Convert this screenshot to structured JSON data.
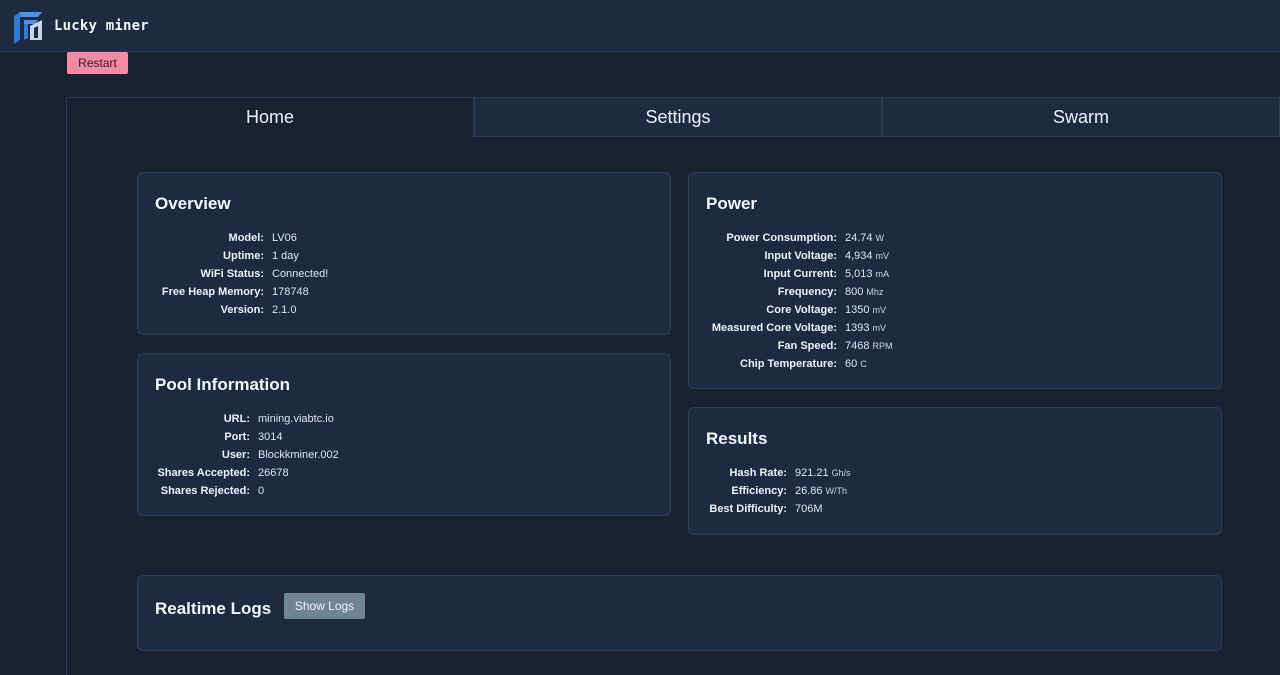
{
  "app": {
    "brand": "Lucky miner",
    "logo_icon": "lucky-miner-logo-icon"
  },
  "toolbar": {
    "restart_label": "Restart"
  },
  "tabs": [
    {
      "label": "Home",
      "active": true
    },
    {
      "label": "Settings",
      "active": false
    },
    {
      "label": "Swarm",
      "active": false
    }
  ],
  "overview": {
    "title": "Overview",
    "rows": [
      {
        "key": "Model:",
        "value": "LV06"
      },
      {
        "key": "Uptime:",
        "value": "1 day"
      },
      {
        "key": "WiFi Status:",
        "value": "Connected!"
      },
      {
        "key": "Free Heap Memory:",
        "value": "178748"
      },
      {
        "key": "Version:",
        "value": "2.1.0"
      }
    ]
  },
  "pool": {
    "title": "Pool Information",
    "rows": [
      {
        "key": "URL:",
        "value": "mining.viabtc.io"
      },
      {
        "key": "Port:",
        "value": "3014"
      },
      {
        "key": "User:",
        "value": "Blockkminer.002"
      },
      {
        "key": "Shares Accepted:",
        "value": "26678"
      },
      {
        "key": "Shares Rejected:",
        "value": "0"
      }
    ]
  },
  "power": {
    "title": "Power",
    "rows": [
      {
        "key": "Power Consumption:",
        "value": "24.74",
        "unit": "W"
      },
      {
        "key": "Input Voltage:",
        "value": "4,934",
        "unit": "mV"
      },
      {
        "key": "Input Current:",
        "value": "5,013",
        "unit": "mA"
      },
      {
        "key": "Frequency:",
        "value": "800",
        "unit": "Mhz"
      },
      {
        "key": "Core Voltage:",
        "value": "1350",
        "unit": "mV"
      },
      {
        "key": "Measured Core Voltage:",
        "value": "1393",
        "unit": "mV"
      },
      {
        "key": "Fan Speed:",
        "value": "7468",
        "unit": "RPM"
      },
      {
        "key": "Chip Temperature:",
        "value": "60",
        "unit": "C"
      }
    ]
  },
  "results": {
    "title": "Results",
    "rows": [
      {
        "key": "Hash Rate:",
        "value": "921.21",
        "unit": "Gh/s"
      },
      {
        "key": "Efficiency:",
        "value": "26.86",
        "unit": "W/Th"
      },
      {
        "key": "Best Difficulty:",
        "value": "706M"
      }
    ]
  },
  "logs": {
    "title": "Realtime Logs",
    "button_label": "Show Logs"
  },
  "colors": {
    "accent_pink": "#f08aa5",
    "card_bg": "#1e2a40",
    "page_bg": "#19202f",
    "logo_blue": "#2f7bd8"
  }
}
